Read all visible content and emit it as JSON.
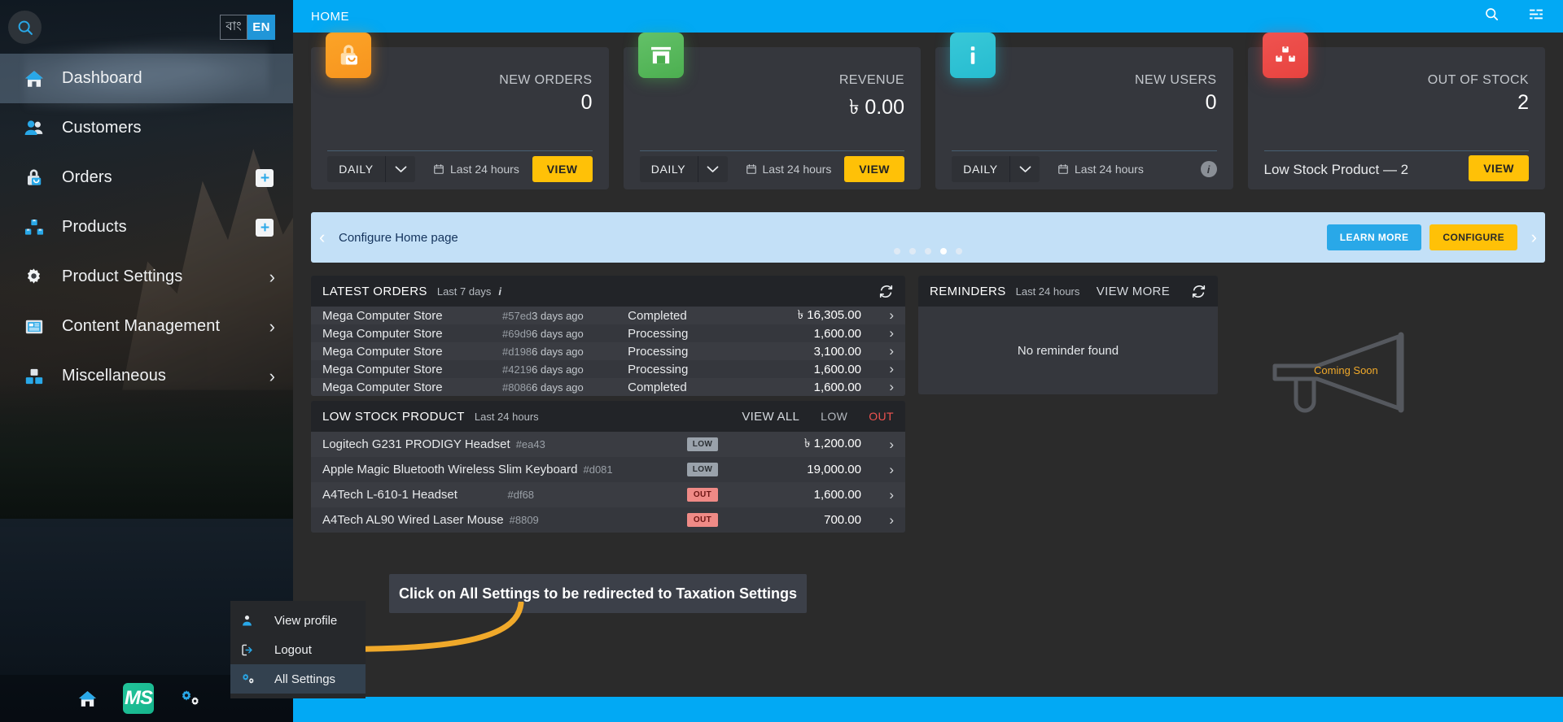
{
  "sidebar": {
    "search_icon": "search-icon",
    "lang": {
      "bn": "বাং",
      "en": "EN"
    },
    "items": [
      {
        "label": "Dashboard",
        "icon": "home-icon",
        "active": true,
        "badge": null,
        "chevron": false
      },
      {
        "label": "Customers",
        "icon": "users-icon",
        "active": false,
        "badge": null,
        "chevron": false
      },
      {
        "label": "Orders",
        "icon": "bag-icon",
        "active": false,
        "badge": "+",
        "chevron": false
      },
      {
        "label": "Products",
        "icon": "boxes-icon",
        "active": false,
        "badge": "+",
        "chevron": false
      },
      {
        "label": "Product Settings",
        "icon": "gear-icon",
        "active": false,
        "badge": null,
        "chevron": true
      },
      {
        "label": "Content Management",
        "icon": "content-icon",
        "active": false,
        "badge": null,
        "chevron": true
      },
      {
        "label": "Miscellaneous",
        "icon": "puzzle-icon",
        "active": false,
        "badge": null,
        "chevron": true
      }
    ],
    "taskbar": [
      {
        "name": "home-icon",
        "label": ""
      },
      {
        "name": "ms-logo-icon",
        "label": "MS"
      },
      {
        "name": "settings-gears-icon",
        "label": ""
      }
    ]
  },
  "context_menu": {
    "items": [
      {
        "label": "View profile",
        "icon": "person-icon",
        "highlighted": false
      },
      {
        "label": "Logout",
        "icon": "logout-icon",
        "highlighted": false
      },
      {
        "label": "All Settings",
        "icon": "settings-gears-icon",
        "highlighted": true
      }
    ]
  },
  "topbar": {
    "title": "HOME",
    "search_icon": "search-icon",
    "filter_icon": "filter-list-icon"
  },
  "cards": [
    {
      "title": "NEW ORDERS",
      "value": "0",
      "icon": "shopping-bag-icon",
      "accent": "#f7941e",
      "period": "DAILY",
      "range": "Last 24 hours",
      "action": "VIEW",
      "has_info": false
    },
    {
      "title": "REVENUE",
      "value": "৳  0.00",
      "icon": "storefront-icon",
      "accent": "#4caf50",
      "period": "DAILY",
      "range": "Last 24 hours",
      "action": "VIEW",
      "has_info": false
    },
    {
      "title": "NEW USERS",
      "value": "0",
      "icon": "info-icon",
      "accent": "#26bcd0",
      "period": "DAILY",
      "range": "Last 24 hours",
      "action": null,
      "has_info": true
    },
    {
      "title": "OUT OF STOCK",
      "value": "2",
      "icon": "boxes-icon",
      "accent": "#e8433f",
      "note": "Low Stock Product — 2",
      "action": "VIEW",
      "has_info": false
    }
  ],
  "banner": {
    "text": "Configure Home page",
    "learn_more": "LEARN MORE",
    "configure": "CONFIGURE",
    "dots": 5,
    "active_dot": 3
  },
  "latest_orders": {
    "title": "LATEST ORDERS",
    "subtitle": "Last 7 days",
    "refresh_icon": "refresh-icon",
    "rows": [
      {
        "name": "Mega Computer Store",
        "id": "#57ed",
        "time": "3 days ago",
        "status": "Completed",
        "amount": "৳ 16,305.00"
      },
      {
        "name": "Mega Computer Store",
        "id": "#69d9",
        "time": "6 days ago",
        "status": "Processing",
        "amount": "1,600.00"
      },
      {
        "name": "Mega Computer Store",
        "id": "#d198",
        "time": "6 days ago",
        "status": "Processing",
        "amount": "3,100.00"
      },
      {
        "name": "Mega Computer Store",
        "id": "#4219",
        "time": "6 days ago",
        "status": "Processing",
        "amount": "1,600.00"
      },
      {
        "name": "Mega Computer Store",
        "id": "#8086",
        "time": "6 days ago",
        "status": "Completed",
        "amount": "1,600.00"
      }
    ]
  },
  "low_stock": {
    "title": "LOW STOCK PRODUCT",
    "subtitle": "Last 24 hours",
    "view_all": "VIEW ALL",
    "tab_low": "LOW",
    "tab_out": "OUT",
    "rows": [
      {
        "name": "Logitech G231 PRODIGY Headset",
        "id": "#ea43",
        "badge": "LOW",
        "amount": "৳ 1,200.00"
      },
      {
        "name": "Apple Magic Bluetooth Wireless Slim Keyboard",
        "id": "#d081",
        "badge": "LOW",
        "amount": "19,000.00"
      },
      {
        "name": "A4Tech L-610-1 Headset",
        "id": "#df68",
        "badge": "OUT",
        "amount": "1,600.00"
      },
      {
        "name": "A4Tech AL90 Wired Laser Mouse",
        "id": "#8809",
        "badge": "OUT",
        "amount": "700.00"
      }
    ]
  },
  "reminders": {
    "title": "REMINDERS",
    "subtitle": "Last 24 hours",
    "view_more": "VIEW MORE",
    "refresh_icon": "refresh-icon",
    "empty_text": "No reminder found"
  },
  "coming_soon": {
    "label": "Coming Soon",
    "icon": "megaphone-icon"
  },
  "tooltip": {
    "text": "Click on All Settings to be redirected to Taxation Settings"
  },
  "colors": {
    "topbar_blue": "#02a9f4",
    "accent_yellow": "#ffc107",
    "panel_bg": "#35373d",
    "panel_head": "#222428",
    "page_bg": "#2b2b2b",
    "banner_bg": "#c3e0f7",
    "out_red": "#ef5350",
    "arrow_orange": "#f0a92a"
  }
}
